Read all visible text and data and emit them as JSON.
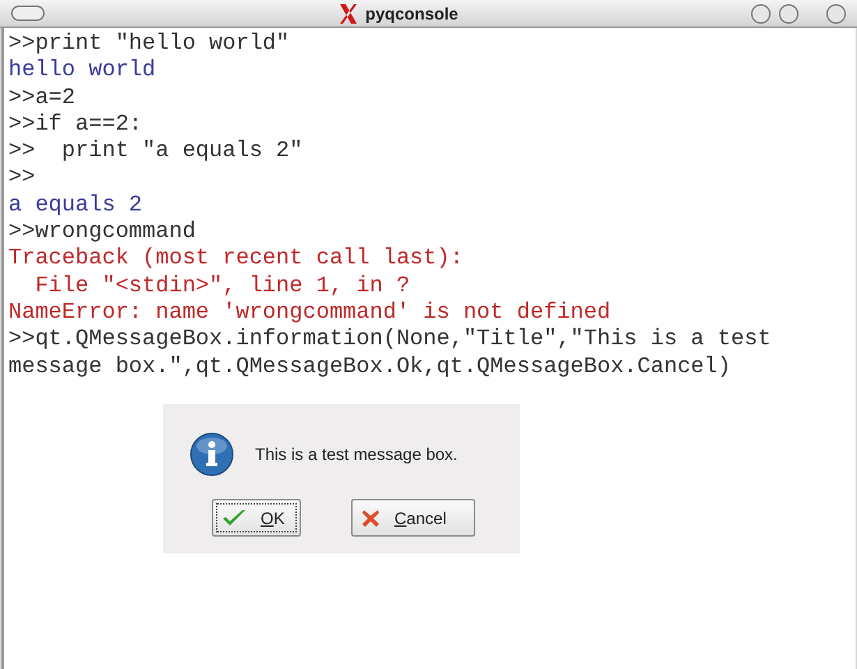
{
  "window": {
    "title": "pyqconsole"
  },
  "console": {
    "lines": [
      {
        "kind": "input",
        "text": ">>print \"hello world\""
      },
      {
        "kind": "output",
        "text": "hello world"
      },
      {
        "kind": "input",
        "text": ">>a=2"
      },
      {
        "kind": "input",
        "text": ">>if a==2:"
      },
      {
        "kind": "input",
        "text": ">>  print \"a equals 2\""
      },
      {
        "kind": "input",
        "text": ">>"
      },
      {
        "kind": "output",
        "text": "a equals 2"
      },
      {
        "kind": "input",
        "text": ">>wrongcommand"
      },
      {
        "kind": "error",
        "text": "Traceback (most recent call last):"
      },
      {
        "kind": "error",
        "text": "  File \"<stdin>\", line 1, in ?"
      },
      {
        "kind": "error",
        "text": "NameError: name 'wrongcommand' is not defined"
      },
      {
        "kind": "input",
        "text": ">>qt.QMessageBox.information(None,\"Title\",\"This is a test"
      },
      {
        "kind": "input",
        "text": "message box.\",qt.QMessageBox.Ok,qt.QMessageBox.Cancel)"
      }
    ]
  },
  "dialog": {
    "message": "This is a test message box.",
    "buttons": [
      {
        "kind": "ok",
        "label": "OK",
        "focused": true,
        "underline_first": true
      },
      {
        "kind": "cancel",
        "label": "Cancel",
        "focused": false,
        "underline_first": true
      }
    ]
  }
}
